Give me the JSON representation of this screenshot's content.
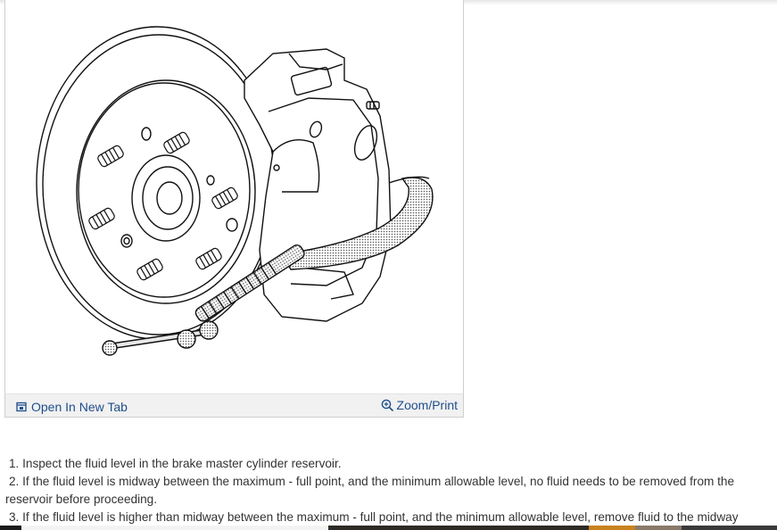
{
  "figure": {
    "image_alt": "brake caliper, rotor and C-clamp illustration",
    "open_tab_label": "Open In New Tab",
    "zoom_label": "Zoom/Print",
    "open_tab_icon": "open-in-new-tab-icon",
    "zoom_icon": "zoom-in-icon"
  },
  "instructions": {
    "steps": [
      "1. Inspect the fluid level in the brake master cylinder reservoir.",
      "2. If the fluid level is midway between the maximum - full point, and the minimum allowable level, no fluid needs to be removed from the reservoir before proceeding.",
      "3. If the fluid level is higher than midway between the maximum - full point, and the minimum allowable level, remove fluid to the midway"
    ]
  },
  "colors": {
    "link": "#1f4e8c",
    "toolbar_bg": "#f1f1f1",
    "text": "#333333",
    "bottom_accent": "#c9821e"
  }
}
